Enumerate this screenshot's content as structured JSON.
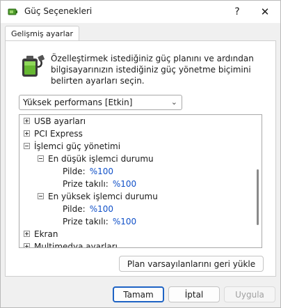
{
  "window": {
    "title": "Güç Seçenekleri",
    "help_label": "?",
    "close_label": "✕"
  },
  "tab": {
    "label": "Gelişmiş ayarlar"
  },
  "description": "Özelleştirmek istediğiniz güç planını ve ardından bilgisayarınızın istediğiniz güç yönetme biçimini belirten ayarları seçin.",
  "plan_select": {
    "value": "Yüksek performans [Etkin]"
  },
  "tree": {
    "usb": "USB ayarları",
    "pci": "PCI Express",
    "cpu": "İşlemci güç yönetimi",
    "min_state": "En düşük işlemci durumu",
    "max_state": "En yüksek işlemci durumu",
    "battery_label": "Pilde:",
    "plugged_label": "Prize takılı:",
    "min_battery": "%100",
    "min_plugged": "%100",
    "max_battery": "%100",
    "max_plugged": "%100",
    "display": "Ekran",
    "multimedia": "Multimedya ayarları"
  },
  "buttons": {
    "restore": "Plan varsayılanlarını geri yükle",
    "ok": "Tamam",
    "cancel": "İptal",
    "apply": "Uygula"
  },
  "colors": {
    "accent": "#1e63c4",
    "link": "#1050c8"
  }
}
